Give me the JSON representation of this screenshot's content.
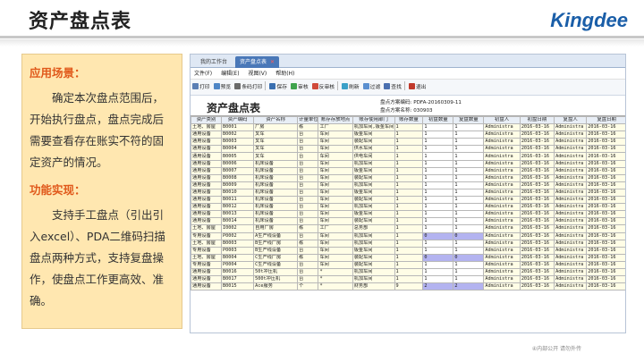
{
  "slide": {
    "title": "资产盘点表",
    "logo": "Kingdee",
    "footer": "④内部公开 请勿外传"
  },
  "left": {
    "scene_title": "应用场景：",
    "scene_text": "确定本次盘点范围后，开始执行盘点，盘点完成后需要查看存在账实不符的固定资产的情况。",
    "func_title": "功能实现：",
    "func_text": "支持手工盘点（引出引入excel）、PDA二维码扫描盘点两种方式，支持复盘操作，使盘点工作更高效、准确。"
  },
  "app": {
    "tabs": [
      {
        "label": "我的工作台"
      },
      {
        "label": "资产盘点表",
        "close": "✕"
      }
    ],
    "menu": [
      "文件(F)",
      "编辑(E)",
      "视图(V)",
      "帮助(H)"
    ],
    "toolbar": [
      {
        "label": "打印",
        "icon": "printer-icon",
        "color": "#5b7fb5"
      },
      {
        "label": "预览",
        "icon": "preview-icon",
        "color": "#4f86c6"
      },
      {
        "label": "条码打印",
        "icon": "barcode-icon",
        "color": "#6a6a6a"
      },
      {
        "label": "保存",
        "icon": "save-icon",
        "color": "#3a6fb0"
      },
      {
        "label": "审核",
        "icon": "approve-icon",
        "color": "#3fa34d"
      },
      {
        "label": "反审核",
        "icon": "unapprove-icon",
        "color": "#d04a3a"
      },
      {
        "label": "刷新",
        "icon": "refresh-icon",
        "color": "#3aa0c8"
      },
      {
        "label": "过滤",
        "icon": "filter-icon",
        "color": "#5a8fd0"
      },
      {
        "label": "查找",
        "icon": "find-icon",
        "color": "#4a6fb0"
      },
      {
        "label": "退出",
        "icon": "exit-icon",
        "color": "#c0392b"
      }
    ],
    "doc_title": "资产盘点表",
    "plan_code": "盘点方案编码: PDFA-20160309-11",
    "plan_name": "盘点方案名称: 030903",
    "columns": [
      "资产类别",
      "资产编码",
      "资产名称",
      "计量单位",
      "账存存放地点",
      "账存使用部门",
      "账存数量",
      "初盘数量",
      "复盘数量",
      "初盘人",
      "初盘日期",
      "复盘人",
      "复盘日期"
    ],
    "rows": [
      [
        "土地、房屋",
        "B0001",
        "厂房",
        "栋",
        "工厂",
        "机加车间,钣金车间",
        "1",
        "1",
        "1",
        "Administra",
        "2016-03-16",
        "Administra",
        "2016-03-16"
      ],
      [
        "通用设备",
        "B0002",
        "叉车",
        "台",
        "车间",
        "钣金车间",
        "1",
        "1",
        "1",
        "Administra",
        "2016-03-16",
        "Administra",
        "2016-03-16"
      ],
      [
        "通用设备",
        "B0003",
        "叉车",
        "台",
        "车间",
        "装配车间",
        "1",
        "1",
        "1",
        "Administra",
        "2016-03-16",
        "Administra",
        "2016-03-16"
      ],
      [
        "通用设备",
        "B0004",
        "叉车",
        "台",
        "车间",
        "供水车间",
        "1",
        "1",
        "1",
        "Administra",
        "2016-03-16",
        "Administra",
        "2016-03-16"
      ],
      [
        "通用设备",
        "B0005",
        "叉车",
        "台",
        "车间",
        "供电车间",
        "1",
        "1",
        "1",
        "Administra",
        "2016-03-16",
        "Administra",
        "2016-03-16"
      ],
      [
        "通用设备",
        "B0006",
        "机床设备",
        "台",
        "车间",
        "机加车间",
        "1",
        "1",
        "1",
        "Administra",
        "2016-03-16",
        "Administra",
        "2016-03-16"
      ],
      [
        "通用设备",
        "B0007",
        "机床设备",
        "台",
        "车间",
        "钣金车间",
        "1",
        "1",
        "1",
        "Administra",
        "2016-03-16",
        "Administra",
        "2016-03-16"
      ],
      [
        "通用设备",
        "B0008",
        "机床设备",
        "台",
        "车间",
        "装配车间",
        "1",
        "1",
        "1",
        "Administra",
        "2016-03-16",
        "Administra",
        "2016-03-16"
      ],
      [
        "通用设备",
        "B0009",
        "机床设备",
        "台",
        "车间",
        "机加车间",
        "1",
        "1",
        "1",
        "Administra",
        "2016-03-16",
        "Administra",
        "2016-03-16"
      ],
      [
        "通用设备",
        "B0010",
        "机床设备",
        "台",
        "车间",
        "钣金车间",
        "1",
        "1",
        "1",
        "Administra",
        "2016-03-16",
        "Administra",
        "2016-03-16"
      ],
      [
        "通用设备",
        "B0011",
        "机床设备",
        "台",
        "车间",
        "装配车间",
        "1",
        "1",
        "1",
        "Administra",
        "2016-03-16",
        "Administra",
        "2016-03-16"
      ],
      [
        "通用设备",
        "B0012",
        "机床设备",
        "台",
        "车间",
        "机加车间",
        "1",
        "1",
        "1",
        "Administra",
        "2016-03-16",
        "Administra",
        "2016-03-16"
      ],
      [
        "通用设备",
        "B0013",
        "机床设备",
        "台",
        "车间",
        "钣金车间",
        "1",
        "1",
        "1",
        "Administra",
        "2016-03-16",
        "Administra",
        "2016-03-16"
      ],
      [
        "通用设备",
        "B0014",
        "机床设备",
        "台",
        "车间",
        "装配车间",
        "1",
        "1",
        "1",
        "Administra",
        "2016-03-16",
        "Administra",
        "2016-03-16"
      ],
      [
        "土地、房屋",
        "I0002",
        "自用厂房",
        "栋",
        "工厂",
        "总务部",
        "1",
        "1",
        "1",
        "Administra",
        "2016-03-16",
        "Administra",
        "2016-03-16"
      ],
      [
        "专用设备",
        "P0002",
        "A生产线设备",
        "台",
        "车间",
        "机加车间",
        "1",
        "0",
        "0",
        "Administra",
        "2016-03-16",
        "Administra",
        "2016-03-16"
      ],
      [
        "土地、房屋",
        "B0003",
        "B生产线厂房",
        "栋",
        "车间",
        "机加车间",
        "1",
        "1",
        "1",
        "Administra",
        "2016-03-16",
        "Administra",
        "2016-03-16"
      ],
      [
        "专用设备",
        "P0003",
        "B生产线设备",
        "台",
        "车间",
        "钣金车间",
        "1",
        "1",
        "1",
        "Administra",
        "2016-03-16",
        "Administra",
        "2016-03-16"
      ],
      [
        "土地、房屋",
        "B0004",
        "C生产线厂房",
        "栋",
        "车间",
        "装配车间",
        "1",
        "0",
        "0",
        "Administra",
        "2016-03-16",
        "Administra",
        "2016-03-16"
      ],
      [
        "专用设备",
        "P0004",
        "C生产线设备",
        "台",
        "车间",
        "装配车间",
        "1",
        "1",
        "1",
        "Administra",
        "2016-03-16",
        "Administra",
        "2016-03-16"
      ],
      [
        "通用设备",
        "B0016",
        "50t冲压机",
        "台",
        "*",
        "机加车间",
        "1",
        "1",
        "1",
        "Administra",
        "2016-03-16",
        "Administra",
        "2016-03-16"
      ],
      [
        "通用设备",
        "B0017",
        "500t冲压机",
        "台",
        "*",
        "机加车间",
        "1",
        "1",
        "1",
        "Administra",
        "2016-03-16",
        "Administra",
        "2016-03-16"
      ],
      [
        "通用设备",
        "B0015",
        "Ace服务",
        "个",
        "*",
        "财务部",
        "9",
        "2",
        "2",
        "Administra",
        "2016-03-16",
        "Administra",
        "2016-03-16"
      ]
    ],
    "highlight_rows": [
      15,
      18,
      22
    ]
  },
  "colors": {
    "accent": "#e0581a",
    "panel_bg": "#ffe7b0",
    "logo": "#1a5ea8",
    "cell_bg": "#fffde6",
    "highlight": "#b3b3f0"
  }
}
